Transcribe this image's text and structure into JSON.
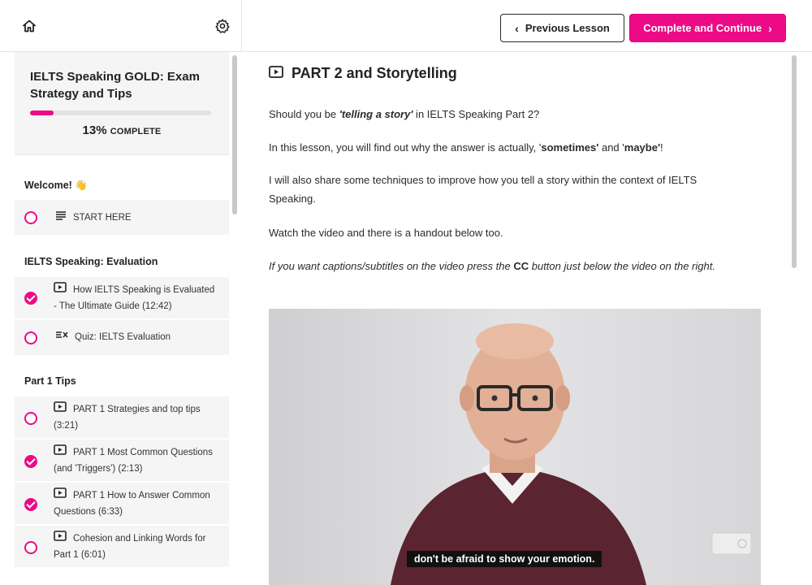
{
  "nav": {
    "home_icon": "home-icon",
    "settings_icon": "gear-icon",
    "prev_label": "Previous Lesson",
    "next_label": "Complete and Continue"
  },
  "course": {
    "title": "IELTS Speaking GOLD: Exam Strategy and Tips",
    "progress_percent": 13,
    "progress_value": "13%",
    "progress_label": "COMPLETE"
  },
  "sections": [
    {
      "title": "Welcome! 👋",
      "lessons": [
        {
          "label": "START HERE",
          "type": "text-icon",
          "completed": false
        }
      ]
    },
    {
      "title": "IELTS Speaking: Evaluation",
      "lessons": [
        {
          "label": "How IELTS Speaking is Evaluated - The Ultimate Guide (12:42)",
          "type": "video-icon",
          "completed": true
        },
        {
          "label": "Quiz: IELTS Evaluation",
          "type": "quiz-icon",
          "completed": false
        }
      ]
    },
    {
      "title": "Part 1 Tips",
      "lessons": [
        {
          "label": "PART 1 Strategies and top tips (3:21)",
          "type": "video-icon",
          "completed": false
        },
        {
          "label": "PART 1 Most Common Questions (and 'Triggers') (2:13)",
          "type": "video-icon",
          "completed": true
        },
        {
          "label": "PART 1 How to Answer Common Questions (6:33)",
          "type": "video-icon",
          "completed": true
        },
        {
          "label": "Cohesion and Linking Words for Part 1 (6:01)",
          "type": "video-icon",
          "completed": false
        }
      ]
    }
  ],
  "lesson": {
    "title": "PART 2 and Storytelling",
    "p1_a": "Should you be ",
    "p1_b": "'telling a story'",
    "p1_c": " in IELTS Speaking Part 2?",
    "p2_a": "In this lesson, you will find out why the answer is actually, '",
    "p2_b": "sometimes'",
    "p2_c": " and '",
    "p2_d": "maybe'",
    "p2_e": "!",
    "p3": "I will also share some techniques to improve how you tell a story within the context of IELTS Speaking.",
    "p4": "Watch the video and there is a handout below too.",
    "p5_a": "If you want captions/subtitles on the video press the ",
    "p5_b": "CC",
    "p5_c": " button just below the video on the right.",
    "video_caption": "don't be afraid to show your emotion."
  },
  "colors": {
    "accent": "#ec0a86",
    "panel": "#f5f5f5"
  }
}
